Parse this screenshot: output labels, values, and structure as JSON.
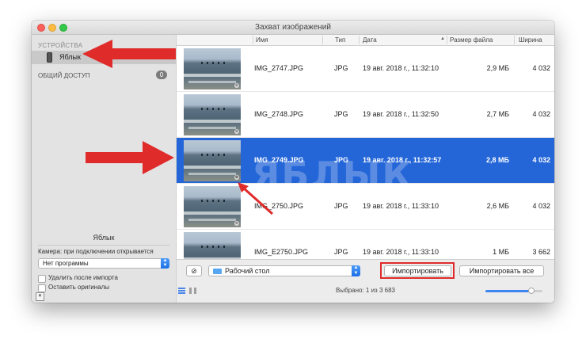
{
  "window": {
    "title": "Захват изображений"
  },
  "sidebar": {
    "devices_header": "УСТРОЙСТВА",
    "device": {
      "name": "Яблык",
      "icon": "iphone-icon"
    },
    "shared_header": "ОБЩИЙ ДОСТУП",
    "shared_count": "0",
    "panel_title": "Яблык",
    "camera_label": "Камера: при подключении открывается",
    "camera_app": "Нет программы",
    "delete_after_import": {
      "label": "Удалить после импорта",
      "checked": false
    },
    "keep_originals": {
      "label": "Оставить оригиналы",
      "checked": false
    }
  },
  "table": {
    "columns": [
      "Имя",
      "Тип",
      "Дата",
      "Размер файла",
      "Ширина"
    ],
    "sort_column": "Дата",
    "rows": [
      {
        "name": "IMG_2747.JPG",
        "type": "JPG",
        "date": "19 авг. 2018 г., 11:32:10",
        "size": "2,9 МБ",
        "width": "4 032",
        "selected": false
      },
      {
        "name": "IMG_2748.JPG",
        "type": "JPG",
        "date": "19 авг. 2018 г., 11:32:50",
        "size": "2,7 МБ",
        "width": "4 032",
        "selected": false
      },
      {
        "name": "IMG_2749.JPG",
        "type": "JPG",
        "date": "19 авг. 2018 г., 11:32:57",
        "size": "2,8 МБ",
        "width": "4 032",
        "selected": true
      },
      {
        "name": "IMG_2750.JPG",
        "type": "JPG",
        "date": "19 авг. 2018 г., 11:33:10",
        "size": "2,6 МБ",
        "width": "4 032",
        "selected": false
      },
      {
        "name": "IMG_E2750.JPG",
        "type": "JPG",
        "date": "19 авг. 2018 г., 11:33:10",
        "size": "1 МБ",
        "width": "3 662",
        "selected": false
      }
    ]
  },
  "bottom_bar": {
    "destination": "Рабочий стол",
    "import_button": "Импортировать",
    "import_all_button": "Импортировать все",
    "status": "Выбрано: 1 из 3 683",
    "zoom_level": 0.8
  },
  "watermark": "ЯБЛЫК",
  "colors": {
    "selection": "#2466d8",
    "annotation": "#e02b2b",
    "accent": "#3d86f0"
  }
}
